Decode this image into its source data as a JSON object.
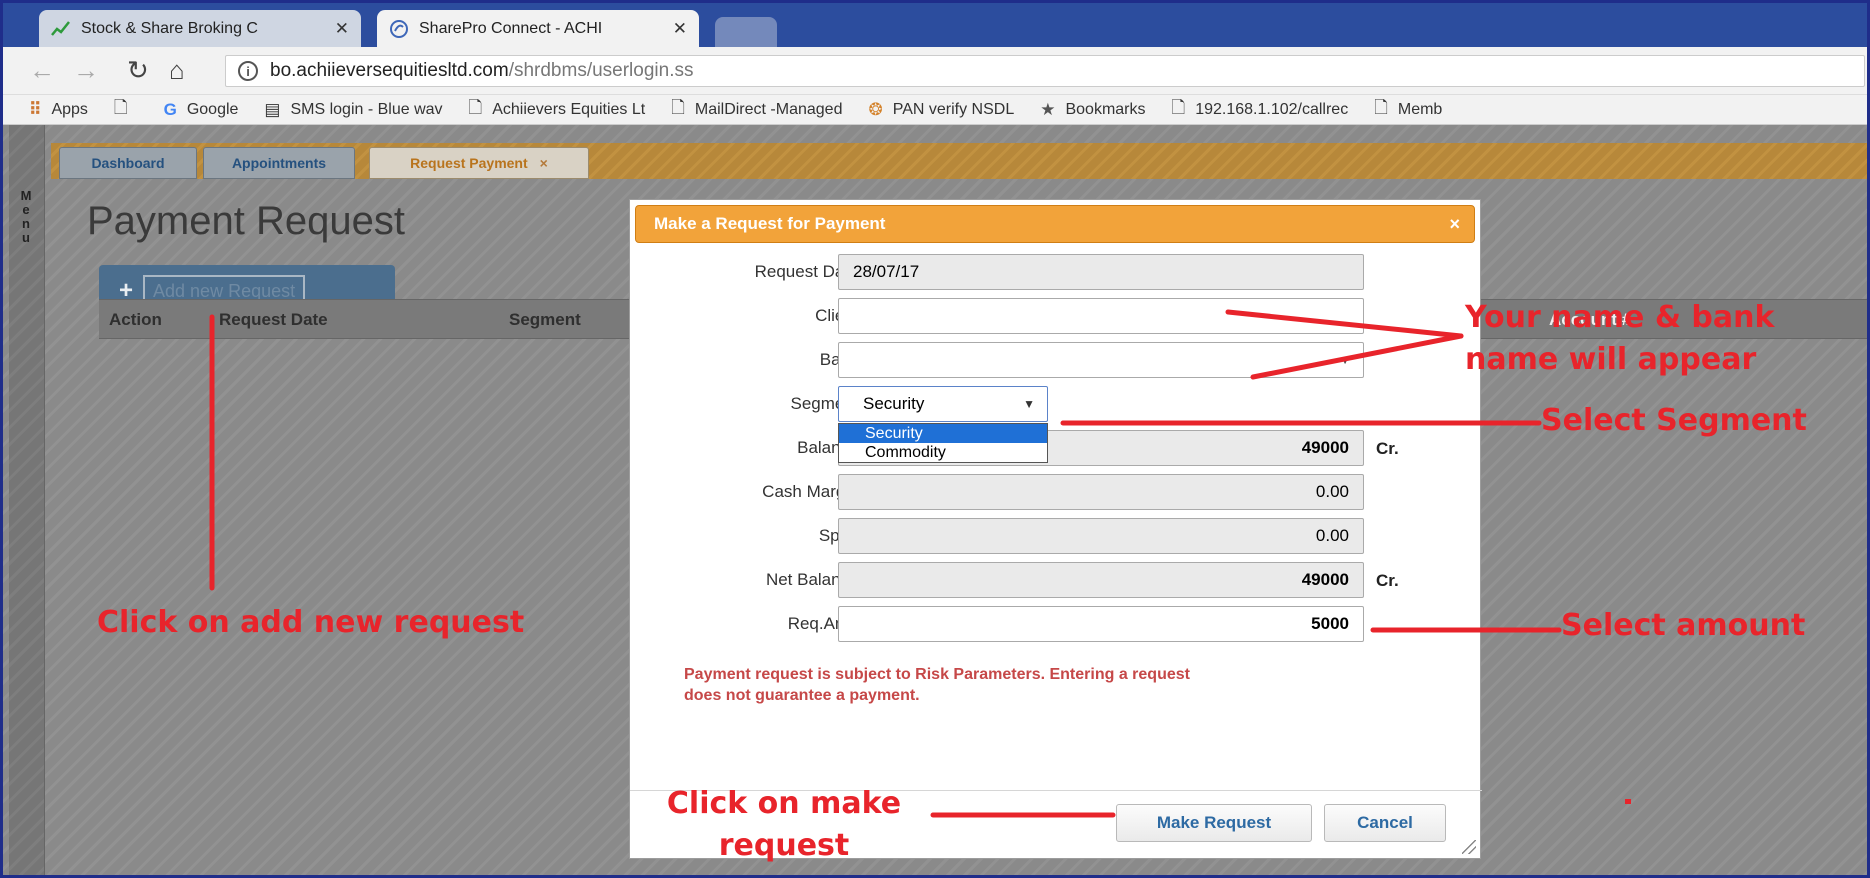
{
  "browser": {
    "tabs": [
      {
        "label": "Stock & Share Broking C",
        "icon": "chart-icon"
      },
      {
        "label": "SharePro Connect - ACHI",
        "icon": "sharepro-icon"
      },
      {
        "label": "",
        "icon": ""
      }
    ],
    "url_host": "bo.achiieversequitiesltd.com",
    "url_path": "/shrdbms/userlogin.ss",
    "bookmarks": [
      {
        "label": "Apps",
        "icon": "apps-grid-icon"
      },
      {
        "label": "",
        "icon": "page-icon"
      },
      {
        "label": "Google",
        "icon": "google-icon"
      },
      {
        "label": "SMS login - Blue wav",
        "icon": "page-icon"
      },
      {
        "label": "Achiievers Equities Lt",
        "icon": "page-icon"
      },
      {
        "label": "MailDirect -Managed",
        "icon": "page-icon"
      },
      {
        "label": "PAN verify NSDL",
        "icon": "pan-icon"
      },
      {
        "label": "Bookmarks",
        "icon": "star-icon"
      },
      {
        "label": "192.168.1.102/callrec",
        "icon": "page-icon"
      },
      {
        "label": "Memb",
        "icon": "page-icon"
      }
    ]
  },
  "app": {
    "menu_label": "Menu",
    "tabs": [
      "Dashboard",
      "Appointments",
      "Request Payment"
    ],
    "tab_close": "×",
    "page_title": "Payment Request",
    "add_button": "Add new Request",
    "grid_columns": [
      "Action",
      "Request Date",
      "Segment",
      "Account #"
    ]
  },
  "modal": {
    "title": "Make a Request for Payment",
    "close": "×",
    "fields": {
      "request_date": {
        "label": "Request Date :",
        "value": "28/07/17"
      },
      "client": {
        "label": "Client :",
        "value": ""
      },
      "bank": {
        "label": "Bank :",
        "value": ""
      },
      "segment": {
        "label": "Segment :",
        "value": "Security",
        "options": [
          "Security",
          "Commodity"
        ]
      },
      "balance": {
        "label": "Balance :",
        "value": "49000",
        "unit": "Cr."
      },
      "cash_margin": {
        "label": "Cash Margin :",
        "value": "0.00"
      },
      "span": {
        "label": "Span :",
        "value": "0.00"
      },
      "net_balance": {
        "label": "Net Balance :",
        "value": "49000",
        "unit": "Cr."
      },
      "req_amt": {
        "label": "Req.Amt. :",
        "value": "5000"
      }
    },
    "disclaimer_line1": "Payment request is subject to Risk Parameters. Entering a request",
    "disclaimer_line2": "does not guarantee a payment.",
    "buttons": {
      "make_request": "Make Request",
      "cancel": "Cancel"
    }
  },
  "annotations": {
    "add_request": "Click on add new request",
    "name_bank_line1": "Your name & bank",
    "name_bank_line2": "name will appear",
    "select_segment": "Select Segment",
    "select_amount": "Select amount",
    "make_request_line1": "Click on make",
    "make_request_line2": "request",
    "color": "#e8242b"
  }
}
